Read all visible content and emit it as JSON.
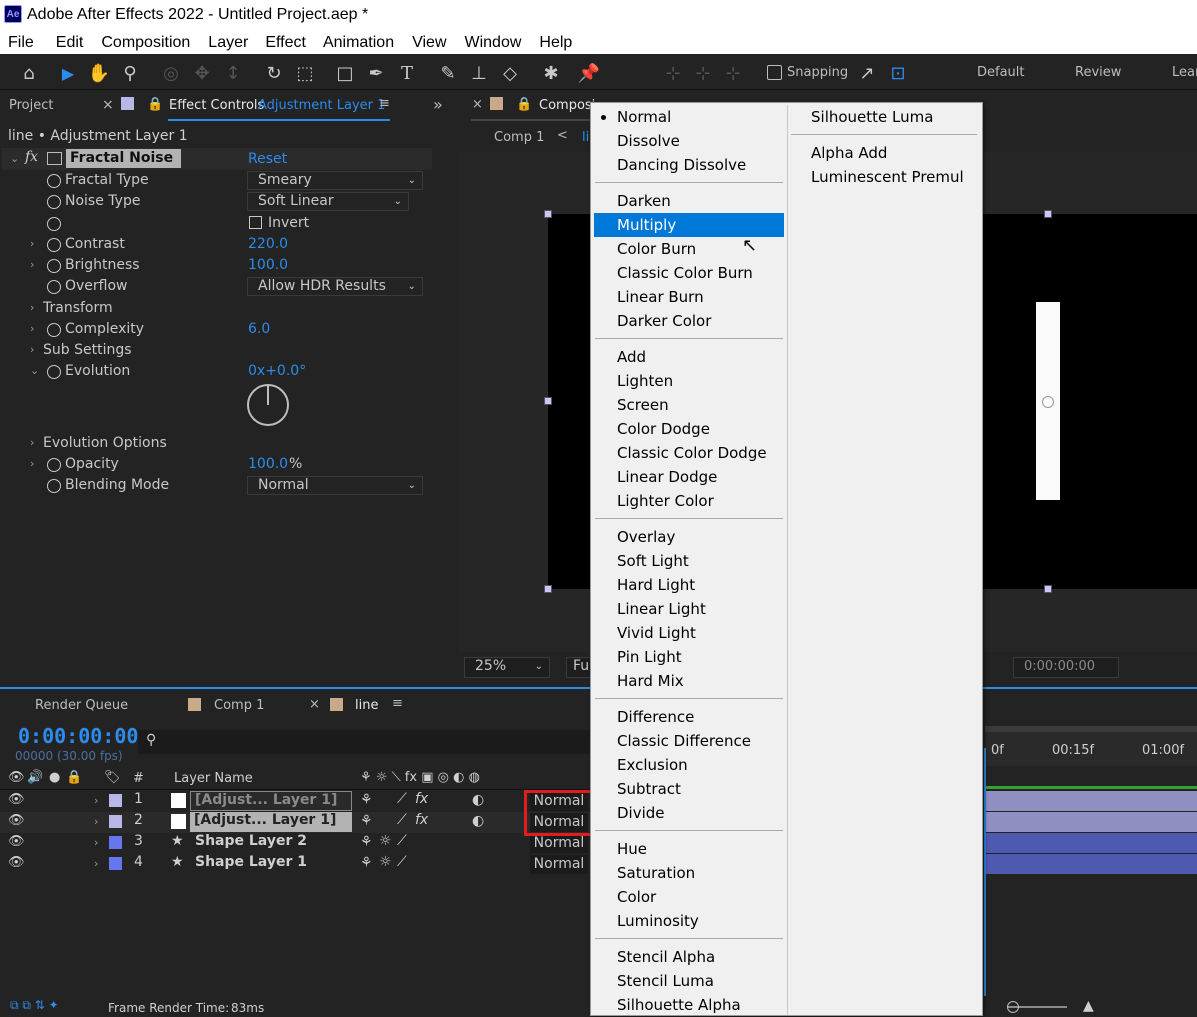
{
  "app": {
    "title": "Adobe After Effects 2022 - Untitled Project.aep *",
    "logo": "Ae"
  },
  "menu": [
    "File",
    "Edit",
    "Composition",
    "Layer",
    "Effect",
    "Animation",
    "View",
    "Window",
    "Help"
  ],
  "toolbar": {
    "snapping_label": "Snapping",
    "workspaces": [
      "Default",
      "Review",
      "Lear"
    ]
  },
  "left_panel": {
    "tab_project": "Project",
    "tab_effect_controls": "Effect Controls",
    "tab_effect_target": "Adjustment Layer 1",
    "breadcrumb": "line • Adjustment Layer 1",
    "effect_name": "Fractal Noise",
    "reset": "Reset",
    "properties": [
      {
        "label": "Fractal Type",
        "value": "Smeary",
        "kind": "dropdown"
      },
      {
        "label": "Noise Type",
        "value": "Soft Linear",
        "kind": "dropdown"
      },
      {
        "label": "",
        "value": "Invert",
        "kind": "checkbox"
      },
      {
        "label": "Contrast",
        "value": "220.0",
        "kind": "number"
      },
      {
        "label": "Brightness",
        "value": "100.0",
        "kind": "number"
      },
      {
        "label": "Overflow",
        "value": "Allow HDR Results",
        "kind": "dropdown"
      },
      {
        "label": "Transform",
        "value": "",
        "kind": "group"
      },
      {
        "label": "Complexity",
        "value": "6.0",
        "kind": "number"
      },
      {
        "label": "Sub Settings",
        "value": "",
        "kind": "group"
      },
      {
        "label": "Evolution",
        "value": "0x+0.0°",
        "kind": "number"
      },
      {
        "label": "Evolution Options",
        "value": "",
        "kind": "group"
      },
      {
        "label": "Opacity",
        "value": "100.0",
        "unit": "%",
        "kind": "number"
      },
      {
        "label": "Blending Mode",
        "value": "Normal",
        "kind": "dropdown"
      }
    ]
  },
  "composition": {
    "tab": "Composi",
    "breadcrumb_comp": "Comp 1",
    "breadcrumb_line": "li",
    "zoom": "25%",
    "resolution": "Ful",
    "timecode": "0:00:00:00"
  },
  "timeline": {
    "tabs": [
      "Render Queue",
      "Comp 1",
      "line"
    ],
    "timecode": "0:00:00:00",
    "frame_info": "00000 (30.00 fps)",
    "col_layer_name": "Layer Name",
    "col_num": "#",
    "ruler": [
      "0f",
      "00:15f",
      "01:00f"
    ],
    "layers": [
      {
        "num": "1",
        "name": "[Adjust... Layer 1]",
        "mode": "Normal",
        "color": "#b7b7e8"
      },
      {
        "num": "2",
        "name": "[Adjust... Layer 1]",
        "mode": "Normal",
        "color": "#b7b7e8"
      },
      {
        "num": "3",
        "name": "Shape Layer 2",
        "mode": "Normal",
        "color": "#6677ee"
      },
      {
        "num": "4",
        "name": "Shape Layer 1",
        "mode": "Normal",
        "color": "#6677ee"
      }
    ],
    "status": "Frame Render Time:",
    "render_time": "83ms"
  },
  "blend_menu": {
    "selected_indicator": "Normal",
    "col1_groups": [
      [
        "Normal",
        "Dissolve",
        "Dancing Dissolve"
      ],
      [
        "Darken",
        "Multiply",
        "Color Burn",
        "Classic Color Burn",
        "Linear Burn",
        "Darker Color"
      ],
      [
        "Add",
        "Lighten",
        "Screen",
        "Color Dodge",
        "Classic Color Dodge",
        "Linear Dodge",
        "Lighter Color"
      ],
      [
        "Overlay",
        "Soft Light",
        "Hard Light",
        "Linear Light",
        "Vivid Light",
        "Pin Light",
        "Hard Mix"
      ],
      [
        "Difference",
        "Classic Difference",
        "Exclusion",
        "Subtract",
        "Divide"
      ],
      [
        "Hue",
        "Saturation",
        "Color",
        "Luminosity"
      ],
      [
        "Stencil Alpha",
        "Stencil Luma",
        "Silhouette Alpha"
      ]
    ],
    "col2_groups": [
      [
        "Silhouette Luma"
      ],
      [
        "Alpha Add",
        "Luminescent Premul"
      ]
    ],
    "highlighted": "Multiply",
    "highlight_color": "#0078d7"
  },
  "colors": {
    "accent": "#2d8ceb",
    "highlight_box": "#e01e1e"
  }
}
